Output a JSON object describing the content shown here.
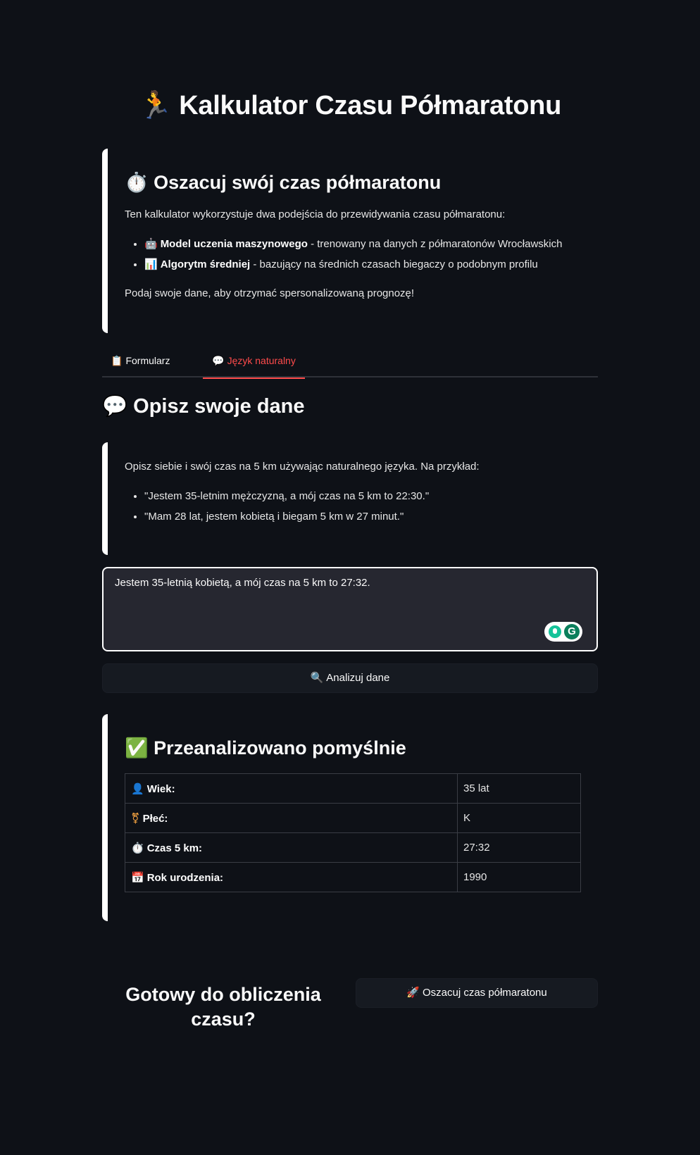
{
  "app": {
    "title": "🏃 Kalkulator Czasu Półmaratonu"
  },
  "info_card": {
    "heading": "⏱️ Oszacuj swój czas półmaratonu",
    "intro": "Ten kalkulator wykorzystuje dwa podejścia do przewidywania czasu półmaratonu:",
    "items": [
      {
        "emoji": "🤖",
        "bold": "Model uczenia maszynowego",
        "text": " - trenowany na danych z półmaratonów Wrocławskich"
      },
      {
        "emoji": "📊",
        "bold": "Algorytm średniej",
        "text": " - bazujący na średnich czasach biegaczy o podobnym profilu"
      }
    ],
    "cta": "Podaj swoje dane, aby otrzymać spersonalizowaną prognozę!"
  },
  "tabs": [
    {
      "emoji": "📋",
      "label": "Formularz",
      "active": false
    },
    {
      "emoji": "💬",
      "label": "Język naturalny",
      "active": true
    }
  ],
  "nl_section": {
    "title": "💬 Opisz swoje dane",
    "hint_intro": "Opisz siebie i swój czas na 5 km używając naturalnego języka. Na przykład:",
    "examples": [
      "\"Jestem 35-letnim mężczyzną, a mój czas na 5 km to 22:30.\"",
      "\"Mam 28 lat, jestem kobietą i biegam 5 km w 27 minut.\""
    ],
    "input_value": "Jestem 35-letnią kobietą, a mój czas na 5 km to 27:32.",
    "analyze_button": {
      "emoji": "🔍",
      "label": "Analizuj dane"
    }
  },
  "result": {
    "heading": "✅ Przeanalizowano pomyślnie",
    "rows": [
      {
        "emoji": "👤",
        "label": "Wiek:",
        "value": "35 lat"
      },
      {
        "emoji": "⚧",
        "label": "Płeć:",
        "value": "K"
      },
      {
        "emoji": "⏱️",
        "label": "Czas 5 km:",
        "value": "27:32"
      },
      {
        "emoji": "📅",
        "label": "Rok urodzenia:",
        "value": "1990"
      }
    ]
  },
  "footer": {
    "ready_title": "Gotowy do obliczenia czasu?",
    "estimate_button": {
      "emoji": "🚀",
      "label": "Oszacuj czas półmaratonu"
    }
  },
  "colors": {
    "background": "#0e1117",
    "accent": "#ff4b4b",
    "input_bg": "#262730"
  },
  "icons": {
    "grammarly_left": "grammarly-suggestion-icon",
    "grammarly_right": "grammarly-g-icon"
  }
}
